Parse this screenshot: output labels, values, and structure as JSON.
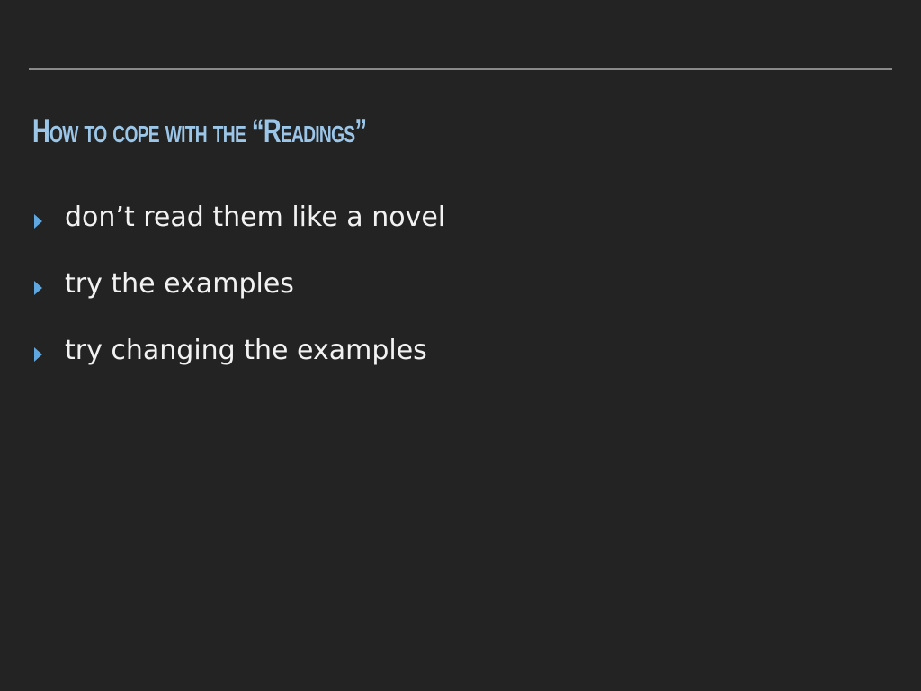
{
  "slide": {
    "title": "How to cope with the “Readings”",
    "bullets": [
      "don’t read them like a novel",
      "try the examples",
      "try changing the examples"
    ],
    "colors": {
      "background": "#232323",
      "title": "#9cc6e8",
      "bullet_icon": "#5fa7e0",
      "text": "#f2f2f2",
      "rule": "#8a8a8a"
    },
    "icons": {
      "bullet": "triangle-right-icon"
    }
  }
}
